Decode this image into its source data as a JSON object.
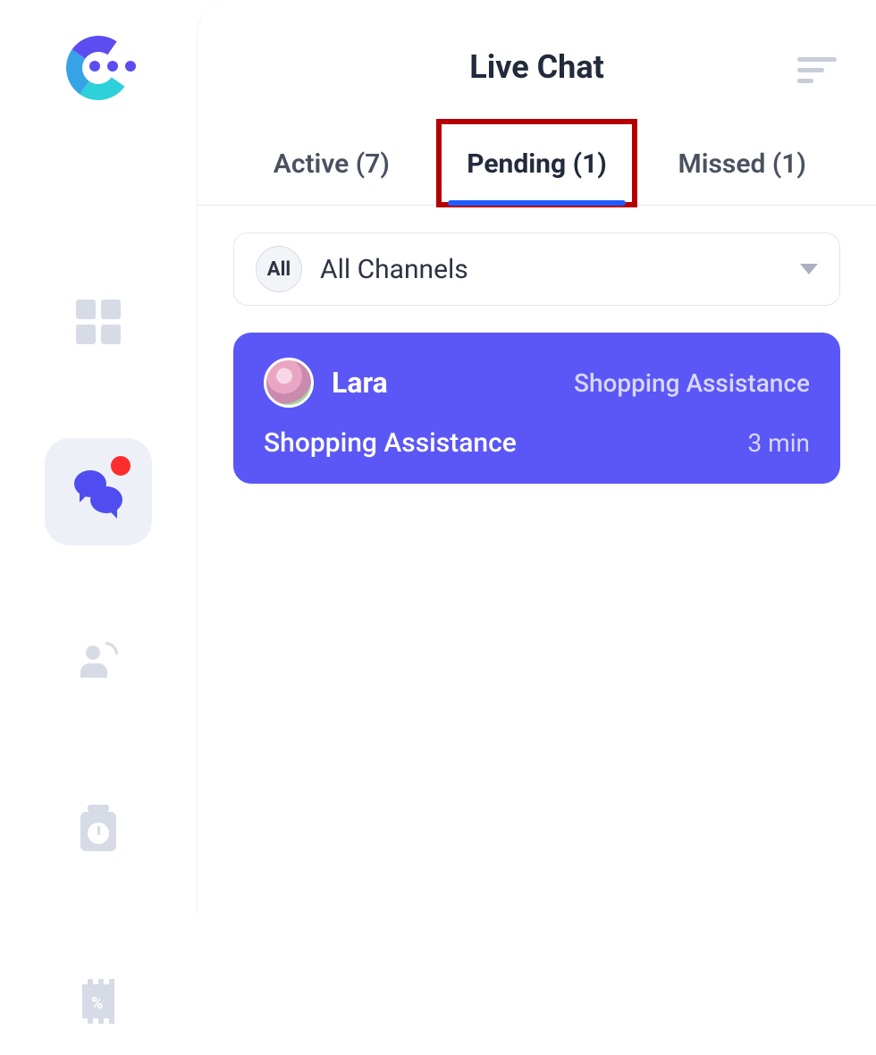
{
  "header": {
    "title": "Live Chat"
  },
  "tabs": {
    "active": "Active (7)",
    "pending": "Pending (1)",
    "missed": "Missed (1)"
  },
  "filter": {
    "pill": "All",
    "label": "All Channels"
  },
  "conversation": {
    "name": "Lara",
    "tag": "Shopping Assistance",
    "subject": "Shopping Assistance",
    "time": "3 min"
  },
  "sidebar": {
    "items": [
      "dashboard",
      "chat",
      "contacts",
      "history",
      "discounts"
    ]
  }
}
